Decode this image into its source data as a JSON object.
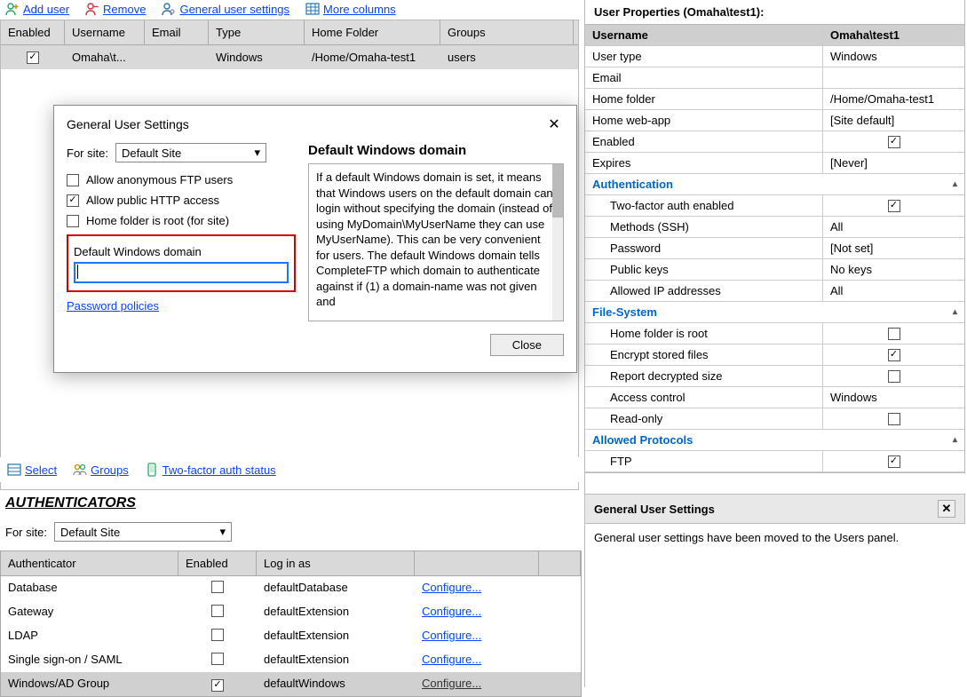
{
  "toolbar": {
    "add_user": "Add user",
    "remove": "Remove",
    "general_settings": "General user settings",
    "more_columns": "More columns"
  },
  "users_table": {
    "headers": {
      "enabled": "Enabled",
      "username": "Username",
      "email": "Email",
      "type": "Type",
      "home": "Home Folder",
      "groups": "Groups"
    },
    "row": {
      "username": "Omaha\\t...",
      "type": "Windows",
      "home": "/Home/Omaha-test1",
      "groups": "users"
    }
  },
  "left_bottom": {
    "select": "Select",
    "groups": "Groups",
    "tfa": "Two-factor auth status"
  },
  "auth": {
    "title": "AUTHENTICATORS",
    "for_site_label": "For site:",
    "site": "Default Site",
    "headers": {
      "a": "Authenticator",
      "e": "Enabled",
      "l": "Log in as"
    },
    "rows": [
      {
        "name": "Database",
        "login": "defaultDatabase",
        "conf": "Configure...",
        "checked": false
      },
      {
        "name": "Gateway",
        "login": "defaultExtension",
        "conf": "Configure...",
        "checked": false
      },
      {
        "name": "LDAP",
        "login": "defaultExtension",
        "conf": "Configure...",
        "checked": false
      },
      {
        "name": "Single sign-on / SAML",
        "login": "defaultExtension",
        "conf": "Configure...",
        "checked": false
      },
      {
        "name": "Windows/AD Group",
        "login": "defaultWindows",
        "conf": "Configure...",
        "checked": true,
        "selected": true
      }
    ]
  },
  "props": {
    "title": "User Properties (Omaha\\test1):",
    "basic": [
      {
        "k": "Username",
        "v": "Omaha\\test1",
        "header": true
      },
      {
        "k": "User type",
        "v": "Windows"
      },
      {
        "k": "Email",
        "v": ""
      },
      {
        "k": "Home folder",
        "v": "/Home/Omaha-test1"
      },
      {
        "k": "Home web-app",
        "v": "[Site default]"
      },
      {
        "k": "Enabled",
        "v": "check"
      },
      {
        "k": "Expires",
        "v": "[Never]"
      }
    ],
    "sec_auth": "Authentication",
    "auth_rows": [
      {
        "k": "Two-factor auth enabled",
        "v": "check"
      },
      {
        "k": "Methods (SSH)",
        "v": "All"
      },
      {
        "k": "Password",
        "v": "[Not set]"
      },
      {
        "k": "Public keys",
        "v": "No keys"
      },
      {
        "k": "Allowed IP addresses",
        "v": "All"
      }
    ],
    "sec_fs": "File-System",
    "fs_rows": [
      {
        "k": "Home folder is root",
        "v": "uncheck"
      },
      {
        "k": "Encrypt stored files",
        "v": "check"
      },
      {
        "k": "Report decrypted size",
        "v": "uncheck"
      },
      {
        "k": "Access control",
        "v": "Windows"
      },
      {
        "k": "Read-only",
        "v": "uncheck"
      }
    ],
    "sec_proto": "Allowed Protocols",
    "proto_rows": [
      {
        "k": "FTP",
        "v": "check"
      }
    ]
  },
  "gus_panel": {
    "title": "General User Settings",
    "body": "General user settings have been moved to the Users panel."
  },
  "dialog": {
    "title": "General User Settings",
    "for_site_label": "For site:",
    "site": "Default Site",
    "allow_anon": "Allow anonymous FTP users",
    "allow_http": "Allow public HTTP access",
    "home_root": "Home folder is root (for site)",
    "dwd_label": "Default Windows domain",
    "pw_policies": "Password policies",
    "help_title": "Default Windows domain",
    "help_text": "If a default Windows domain is set, it means that Windows users on the default domain can login without specifying the domain (instead of using MyDomain\\MyUserName they can use MyUserName). This can be very convenient for users. The default Windows domain tells CompleteFTP which domain to authenticate against if (1) a domain-name was not given and",
    "close": "Close"
  }
}
